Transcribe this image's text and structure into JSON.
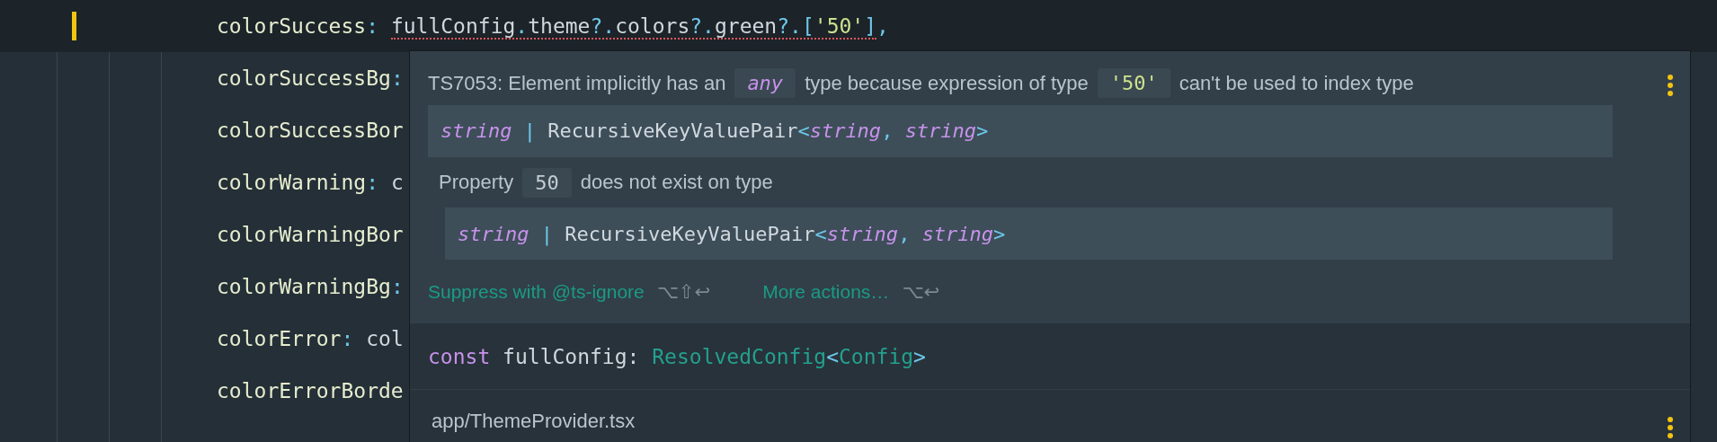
{
  "editor": {
    "lines": [
      {
        "current": true,
        "modified": true,
        "segments": [
          {
            "error": false,
            "tokens": [
              {
                "kind": "prop",
                "text": "colorSuccess"
              },
              {
                "kind": "punct",
                "text": ": "
              }
            ]
          },
          {
            "error": true,
            "tokens": [
              {
                "kind": "ident",
                "text": "fullConfig"
              },
              {
                "kind": "punct",
                "text": "."
              },
              {
                "kind": "ident",
                "text": "theme"
              },
              {
                "kind": "punct",
                "text": "?."
              },
              {
                "kind": "ident",
                "text": "colors"
              },
              {
                "kind": "punct",
                "text": "?."
              },
              {
                "kind": "ident",
                "text": "green"
              },
              {
                "kind": "punct",
                "text": "?."
              },
              {
                "kind": "punct",
                "text": "["
              },
              {
                "kind": "string",
                "text": "'50'"
              },
              {
                "kind": "punct",
                "text": "]"
              }
            ]
          },
          {
            "error": false,
            "tokens": [
              {
                "kind": "punct",
                "text": ","
              }
            ]
          }
        ]
      },
      {
        "current": false,
        "modified": false,
        "segments": [
          {
            "error": false,
            "tokens": [
              {
                "kind": "prop",
                "text": "colorSuccessBg"
              },
              {
                "kind": "punct",
                "text": ":"
              }
            ]
          }
        ]
      },
      {
        "current": false,
        "modified": false,
        "segments": [
          {
            "error": false,
            "tokens": [
              {
                "kind": "prop",
                "text": "colorSuccessBor"
              }
            ]
          }
        ]
      },
      {
        "current": false,
        "modified": false,
        "segments": [
          {
            "error": false,
            "tokens": [
              {
                "kind": "prop",
                "text": "colorWarning"
              },
              {
                "kind": "punct",
                "text": ": "
              },
              {
                "kind": "ident",
                "text": "c"
              }
            ]
          }
        ]
      },
      {
        "current": false,
        "modified": false,
        "segments": [
          {
            "error": false,
            "tokens": [
              {
                "kind": "prop",
                "text": "colorWarningBor"
              }
            ]
          }
        ]
      },
      {
        "current": false,
        "modified": false,
        "segments": [
          {
            "error": false,
            "tokens": [
              {
                "kind": "prop",
                "text": "colorWarningBg"
              },
              {
                "kind": "punct",
                "text": ":"
              }
            ]
          }
        ]
      },
      {
        "current": false,
        "modified": false,
        "segments": [
          {
            "error": false,
            "tokens": [
              {
                "kind": "prop",
                "text": "colorError"
              },
              {
                "kind": "punct",
                "text": ": "
              },
              {
                "kind": "ident",
                "text": "col"
              }
            ]
          }
        ]
      },
      {
        "current": false,
        "modified": false,
        "segments": [
          {
            "error": false,
            "tokens": [
              {
                "kind": "prop",
                "text": "colorErrorBorde"
              }
            ]
          }
        ]
      }
    ]
  },
  "popup": {
    "message": [
      {
        "kind": "text",
        "text": "TS7053: Element implicitly has an"
      },
      {
        "kind": "type_keyword",
        "text": "any"
      },
      {
        "kind": "text",
        "text": "type because expression of type"
      },
      {
        "kind": "string",
        "text": "'50'"
      },
      {
        "kind": "text",
        "text": "can't be used to index type"
      }
    ],
    "type_block": [
      {
        "kind": "type_keyword",
        "text": "string"
      },
      {
        "kind": "punct",
        "text": " | "
      },
      {
        "kind": "ident",
        "text": "RecursiveKeyValuePair"
      },
      {
        "kind": "punct",
        "text": "<"
      },
      {
        "kind": "type_keyword",
        "text": "string"
      },
      {
        "kind": "punct",
        "text": ", "
      },
      {
        "kind": "type_keyword",
        "text": "string"
      },
      {
        "kind": "punct",
        "text": ">"
      }
    ],
    "detail": [
      {
        "kind": "text",
        "text": "Property"
      },
      {
        "kind": "number",
        "text": "50"
      },
      {
        "kind": "text",
        "text": "does not exist on type"
      }
    ],
    "detail_block": [
      {
        "kind": "type_keyword",
        "text": "string"
      },
      {
        "kind": "punct",
        "text": " | "
      },
      {
        "kind": "ident",
        "text": "RecursiveKeyValuePair"
      },
      {
        "kind": "punct",
        "text": "<"
      },
      {
        "kind": "type_keyword",
        "text": "string"
      },
      {
        "kind": "punct",
        "text": ", "
      },
      {
        "kind": "type_keyword",
        "text": "string"
      },
      {
        "kind": "punct",
        "text": ">"
      }
    ],
    "actions": [
      {
        "label": "Suppress with @ts-ignore",
        "shortcut": "⌥⇧↩"
      },
      {
        "label": "More actions…",
        "shortcut": "⌥↩"
      }
    ],
    "declaration": [
      {
        "kind": "keyword",
        "text": "const"
      },
      {
        "kind": "ident",
        "text": " fullConfig: "
      },
      {
        "kind": "type",
        "text": "ResolvedConfig"
      },
      {
        "kind": "punct",
        "text": "<"
      },
      {
        "kind": "type",
        "text": "Config"
      },
      {
        "kind": "punct",
        "text": ">"
      }
    ],
    "file": "app/ThemeProvider.tsx"
  }
}
